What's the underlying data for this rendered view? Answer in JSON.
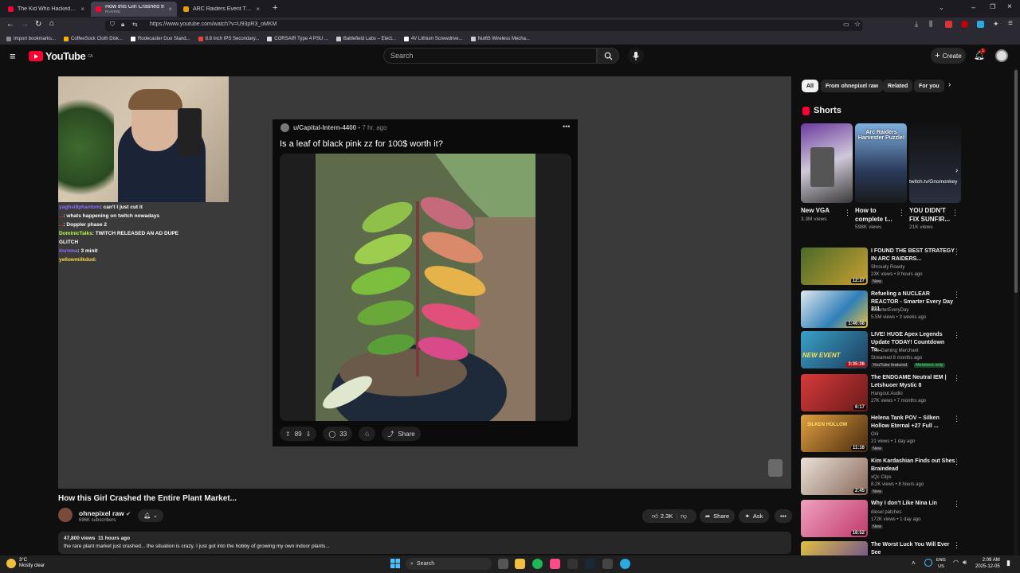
{
  "browser": {
    "tabs": [
      {
        "title": "The Kid Who Hacked the Penta",
        "active": false,
        "favicon_color": "#ff0033"
      },
      {
        "title": "How this Girl Crashed the Entire",
        "subtitle": "PLAYING",
        "active": true,
        "favicon_color": "#ff0033"
      },
      {
        "title": "ARC Raiders Event Timers | Me",
        "active": false,
        "favicon_color": "#e0a000"
      }
    ],
    "new_tab_label": "+",
    "url": "https://www.youtube.com/watch?v=U93pR3_oMKM",
    "bookmarks": [
      {
        "label": "Import bookmarks...",
        "color": "#8a8a8a"
      },
      {
        "label": "CoffeeSock Cloth Disk...",
        "color": "#f3b300"
      },
      {
        "label": "Rodecaster Duo Stand...",
        "color": "#ffffff"
      },
      {
        "label": "8.8 Inch IPS Secondary...",
        "color": "#e7453c"
      },
      {
        "label": "CORSAIR Type 4 PSU ...",
        "color": "#dddddd"
      },
      {
        "label": "Battlefield Labs – Elect...",
        "color": "#cccccc"
      },
      {
        "label": "4V Lithium Screwdrive...",
        "color": "#ffffff"
      },
      {
        "label": "Nut65 Wireless Mecha...",
        "color": "#cccccc"
      }
    ]
  },
  "youtube": {
    "logo": "YouTube",
    "region": "CA",
    "search_placeholder": "Search",
    "create_label": "Create",
    "notifications": "1"
  },
  "video": {
    "title": "How this Girl Crashed the Entire Plant Market...",
    "channel": "ohnepixel raw",
    "subscribers": "696K subscribers",
    "likes": "2.3K",
    "share_label": "Share",
    "ask_label": "Ask",
    "views": "47,800 views",
    "age": "11 hours ago",
    "description": "the rare plant market just crashed... the situation is crazy. I just got into the hobby of growing my own indoor plants..."
  },
  "stream": {
    "chat": [
      {
        "user": "yaghsl8phantom",
        "msg": "can't I just cut it"
      },
      {
        "user": "...",
        "msg": "whats happening on twitch nowadays"
      },
      {
        "user": "...",
        "msg": "Doppler phase 2"
      },
      {
        "user": "DominicTalks",
        "msg": "TWITCH RELEASED AN AD DUPE GLITCH"
      },
      {
        "user": "itsrnma",
        "msg": "3 minit"
      },
      {
        "user": "yellowmilkdud",
        "msg": ""
      }
    ],
    "post_user": "u/Capital-Intern-4400",
    "post_age": "7 hr. ago",
    "post_title": "Is a leaf of black pink zz for 100$ worth it?",
    "upvotes": "89",
    "comments": "33",
    "share": "Share"
  },
  "sidebar": {
    "chips": [
      "All",
      "From ohnepixel raw",
      "Related",
      "For you"
    ],
    "shorts_heading": "Shorts",
    "shorts": [
      {
        "title": "New VGA",
        "views": "3.3M views",
        "overlay": ""
      },
      {
        "title": "How to complete t...",
        "views": "598K views",
        "overlay": "Arc Raiders Harvester Puzzle!"
      },
      {
        "title": "YOU DIDN'T FIX SUNFIR...",
        "views": "21K views",
        "overlay": "twitch.tv/Gnomonkey"
      }
    ],
    "recommended": [
      {
        "title": "I FOUND THE BEST STRATEGY IN ARC RAIDERS...",
        "channel": "Shroudy Rowdy",
        "meta": "23K views • 8 hours ago",
        "badge": "New",
        "duration": "12:27",
        "color": "#4a6a2a"
      },
      {
        "title": "Refueling a NUCLEAR REACTOR - Smarter Every Day 311",
        "channel": "SmarterEveryDay",
        "meta": "5.5M views • 3 weeks ago",
        "badge": "",
        "duration": "1:46:08",
        "color": "#2f7fb8"
      },
      {
        "title": "LIVE! HUGE Apex Legends Update TODAY! Countdown To...",
        "channel": "The Gaming Merchant",
        "meta": "Streamed 8 months ago",
        "badge": "YouTube featured",
        "badge2": "Members only",
        "duration": "3:35:26",
        "color": "#3aa0c9"
      },
      {
        "title": "The ENDGAME Neutral IEM | Letshuoer Mystic 8",
        "channel": "Hangout.Audio",
        "meta": "27K views • 7 months ago",
        "badge": "",
        "duration": "6:17",
        "color": "#b52a2a"
      },
      {
        "title": "Helena Tank POV – Silken Hollow Eternal +27 Full ...",
        "channel": "Orii",
        "meta": "21 views • 1 day ago",
        "badge": "New",
        "duration": "11:16",
        "color": "#8a4a1a"
      },
      {
        "title": "Kim Kardashian Finds out Shes Braindead",
        "channel": "xQc Clips",
        "meta": "8.2K views • 8 hours ago",
        "badge": "New",
        "duration": "2:45",
        "color": "#c9b9a8"
      },
      {
        "title": "Why I don't Like Nina Lin",
        "channel": "diesel patches",
        "meta": "172K views • 1 day ago",
        "badge": "New",
        "duration": "18:52",
        "color": "#c03a6a"
      },
      {
        "title": "The Worst Luck You Will Ever See",
        "channel": "",
        "meta": "",
        "badge": "",
        "duration": "",
        "color": "#a08a30"
      }
    ]
  },
  "taskbar": {
    "temp": "3°C",
    "weather": "Mostly clear",
    "search": "Search",
    "lang": "ENG",
    "region": "US",
    "time": "2:09 AM",
    "date": "2025-12-05"
  }
}
